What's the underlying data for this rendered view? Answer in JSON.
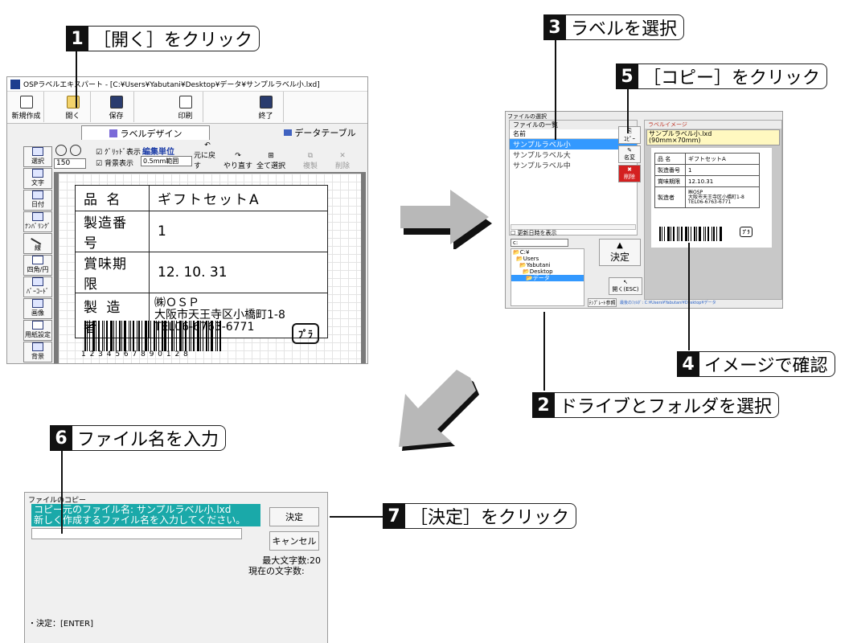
{
  "callouts": {
    "c1": {
      "num": "1",
      "text": "［開く］をクリック"
    },
    "c2": {
      "num": "2",
      "text": "ドライブとフォルダを選択"
    },
    "c3": {
      "num": "3",
      "text": "ラベルを選択"
    },
    "c4": {
      "num": "4",
      "text": "イメージで確認"
    },
    "c5": {
      "num": "5",
      "text": "［コピー］をクリック"
    },
    "c6": {
      "num": "6",
      "text": "ファイル名を入力"
    },
    "c7": {
      "num": "7",
      "text": "［決定］をクリック"
    }
  },
  "main_window": {
    "title": "OSPラベルエキスパート - [C:¥Users¥Yabutani¥Desktop¥データ¥サンプルラベル小.lxd]",
    "toolbar": [
      {
        "label": "新規作成",
        "icon": "new-file-icon"
      },
      {
        "label": "開く",
        "icon": "open-folder-icon"
      },
      {
        "label": "保存",
        "icon": "save-icon"
      },
      {
        "label": "印刷",
        "icon": "print-icon"
      },
      {
        "label": "終了",
        "icon": "exit-icon"
      }
    ],
    "tabs": {
      "design": "ラベルデザイン",
      "data": "データテーブル"
    },
    "zoom_value": "150",
    "grid_show": "ｸﾞﾘｯﾄﾞ表示",
    "bg_show": "背景表示",
    "edit_unit_label": "編集単位",
    "edit_unit_value": "0.5mm範囲",
    "actions": [
      "元に戻す",
      "やり直す",
      "全て選択",
      "複製",
      "削除"
    ],
    "side_tools": [
      "選択",
      "文字",
      "日付",
      "ﾅﾝﾊﾞﾘﾝｸﾞ",
      "線",
      "四角/円",
      "ﾊﾞｰｺｰﾄﾞ",
      "画像",
      "用紙設定",
      "背景"
    ],
    "label": {
      "rows": [
        {
          "key": "品 名",
          "value": "ギフトセットA"
        },
        {
          "key": "製造番号",
          "value": "1"
        },
        {
          "key": "賞味期限",
          "value": "12. 10. 31"
        }
      ],
      "maker_key": "製 造 者",
      "maker_lines": [
        "㈱ＯＳＰ",
        "大阪市天王寺区小橋町1-8",
        "TEL06-6763-6771"
      ],
      "barcode_digits": "1 2 3 4 5 6 7 8 9 0 1 2 8"
    }
  },
  "file_window": {
    "title": "ファイルの選択",
    "list_title": "ファイルの一覧",
    "list_header": "名前",
    "files": [
      "サンプルラベル小",
      "サンプルラベル大",
      "サンプルラベル中"
    ],
    "show_date": "更新日時を表示",
    "drive": "c:",
    "folders": [
      "C:¥",
      "Users",
      "Yabutani",
      "Desktop",
      "データ"
    ],
    "copy_btn": "ｺﾋﾟｰ",
    "rename_btn": "名変",
    "delete_btn": "削除",
    "decide_btn": "決定",
    "open_btn": "開く(ESC)",
    "template_btn": "ﾃﾝﾌﾟﾚｰﾄ参照",
    "status_path": "最後のﾌｫﾙﾀﾞ: C:¥Users¥Yabutani¥Desktop¥データ",
    "preview_title": "ラベルイメージ",
    "preview_name": "サンプルラベル小.lxd",
    "preview_size": "(90mm×70mm)",
    "preview_rows": [
      {
        "key": "品 名",
        "value": "ギフトセットA"
      },
      {
        "key": "製造番号",
        "value": "1"
      },
      {
        "key": "賞味期限",
        "value": "12.10.31"
      }
    ],
    "preview_maker_key": "製造者",
    "preview_maker_lines": [
      "㈱OSP",
      "大阪市天王寺区小橋町1-8",
      "TEL06-6763-6771"
    ]
  },
  "copy_window": {
    "title": "ファイルのコピー",
    "line1": "コピー元のファイル名: サンプルラベル小.lxd",
    "line2": "新しく作成するファイル名を入力してください。",
    "input_value": "",
    "decide": "決定",
    "cancel": "キャンセル",
    "max_chars": "最大文字数:20",
    "current_chars": "現在の文字数:",
    "hint": "・決定：[ENTER]"
  }
}
